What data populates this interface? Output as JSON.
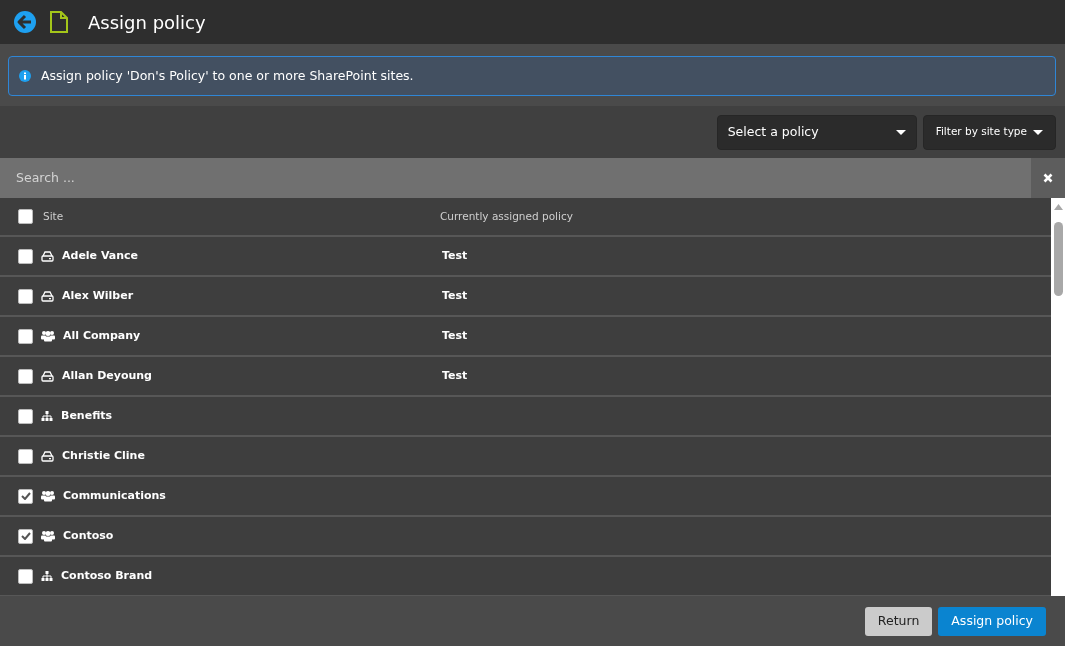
{
  "header": {
    "title": "Assign policy"
  },
  "info": {
    "message": "Assign policy 'Don's Policy' to one or more SharePoint sites."
  },
  "toolbar": {
    "policy_select": {
      "placeholder": "Select a policy"
    },
    "filter_button": "Filter by site type"
  },
  "search": {
    "placeholder": "Search ..."
  },
  "table": {
    "select_all_checked": false,
    "columns": [
      "Site",
      "Currently assigned policy"
    ],
    "rows": [
      {
        "kind": "drive",
        "site": "Adele Vance",
        "policy": "Test",
        "checked": false
      },
      {
        "kind": "drive",
        "site": "Alex Wilber",
        "policy": "Test",
        "checked": false
      },
      {
        "kind": "group",
        "site": "All Company",
        "policy": "Test",
        "checked": false
      },
      {
        "kind": "drive",
        "site": "Allan Deyoung",
        "policy": "Test",
        "checked": false
      },
      {
        "kind": "hierarchy",
        "site": "Benefits",
        "policy": "",
        "checked": false
      },
      {
        "kind": "drive",
        "site": "Christie Cline",
        "policy": "",
        "checked": false
      },
      {
        "kind": "group",
        "site": "Communications",
        "policy": "",
        "checked": true
      },
      {
        "kind": "group",
        "site": "Contoso",
        "policy": "",
        "checked": true
      },
      {
        "kind": "hierarchy",
        "site": "Contoso Brand",
        "policy": "",
        "checked": false
      }
    ]
  },
  "footer": {
    "buttons": [
      {
        "kind": "secondary",
        "label": "Return"
      },
      {
        "kind": "primary",
        "label": "Assign policy"
      }
    ]
  }
}
